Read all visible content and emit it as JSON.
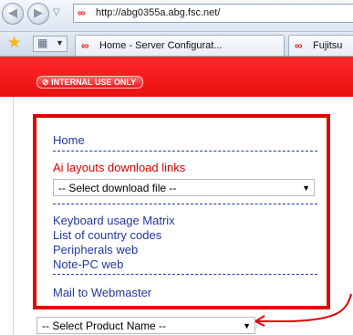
{
  "browser": {
    "address_url": "http://abg0355a.abg.fsc.net/",
    "tabs": [
      {
        "label": "Home - Server Configurat..."
      },
      {
        "label": "Fujitsu"
      }
    ]
  },
  "page": {
    "badge_text": "INTERNAL USE ONLY",
    "nav": {
      "home": "Home",
      "ai_layouts": "Ai layouts download links",
      "download_select": "-- Select download file --",
      "keyboard_matrix": "Keyboard usage Matrix",
      "country_codes": "List of country codes",
      "peripherals": "Peripherals web",
      "notepc": "Note-PC web",
      "mail": "Mail to Webmaster"
    },
    "product_select": "-- Select Product Name --"
  },
  "colors": {
    "brand_red": "#e90f0f",
    "link_blue": "#2337a3",
    "highlight_box": "#e30000"
  },
  "icons": [
    "back-icon",
    "forward-icon",
    "fujitsu-favicon",
    "star-icon",
    "grid-icon"
  ]
}
